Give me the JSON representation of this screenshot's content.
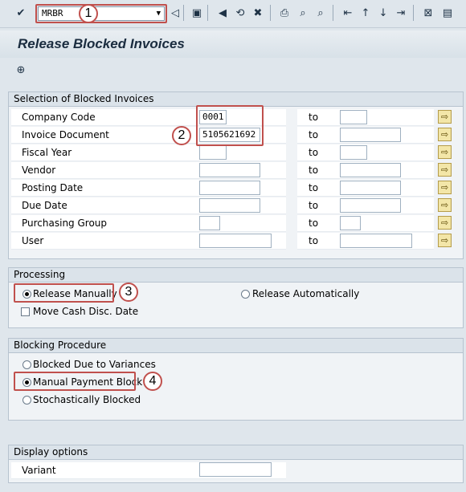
{
  "toolbar": {
    "command": "MRBR"
  },
  "title": "Release Blocked Invoices",
  "selection": {
    "header": "Selection of Blocked Invoices",
    "to_label": "to",
    "rows": [
      {
        "label": "Company Code",
        "from": "0001",
        "to": ""
      },
      {
        "label": "Invoice Document",
        "from": "5105621692",
        "to": ""
      },
      {
        "label": "Fiscal Year",
        "from": "",
        "to": ""
      },
      {
        "label": "Vendor",
        "from": "",
        "to": ""
      },
      {
        "label": "Posting Date",
        "from": "",
        "to": ""
      },
      {
        "label": "Due Date",
        "from": "",
        "to": ""
      },
      {
        "label": "Purchasing Group",
        "from": "",
        "to": ""
      },
      {
        "label": "User",
        "from": "",
        "to": ""
      }
    ]
  },
  "processing": {
    "header": "Processing",
    "release_manually": "Release Manually",
    "release_automatically": "Release Automatically",
    "move_cash_disc": "Move Cash Disc. Date"
  },
  "blocking": {
    "header": "Blocking Procedure",
    "variances": "Blocked Due to Variances",
    "manual": "Manual Payment Block",
    "stochastic": "Stochastically Blocked"
  },
  "display": {
    "header": "Display options",
    "variant_label": "Variant",
    "variant_value": ""
  },
  "badges": [
    "1",
    "2",
    "3",
    "4"
  ]
}
